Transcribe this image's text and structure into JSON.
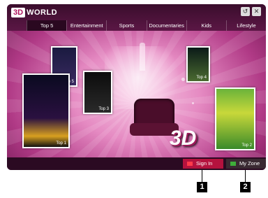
{
  "header": {
    "logo_mark": "3D",
    "logo_text": "WORLD",
    "back_icon": "back-icon",
    "close_icon": "close-icon",
    "back_glyph": "↺",
    "close_glyph": "✕"
  },
  "tabs": [
    {
      "label": "Top 5"
    },
    {
      "label": "Entertainment"
    },
    {
      "label": "Sports"
    },
    {
      "label": "Documentaries"
    },
    {
      "label": "Kids"
    },
    {
      "label": "Lifestyle"
    }
  ],
  "thumbnails": [
    {
      "rank": "Top 1"
    },
    {
      "rank": "Top 2"
    },
    {
      "rank": "Top 3"
    },
    {
      "rank": "Top 4"
    },
    {
      "rank": "Top 5"
    }
  ],
  "center_logo": "3D",
  "bottom": {
    "sign_in_label": "Sign In",
    "my_zone_label": "My Zone",
    "sign_in_color": "#d0243c",
    "my_zone_color": "#3fae3a"
  },
  "callouts": {
    "one": "1",
    "two": "2"
  }
}
